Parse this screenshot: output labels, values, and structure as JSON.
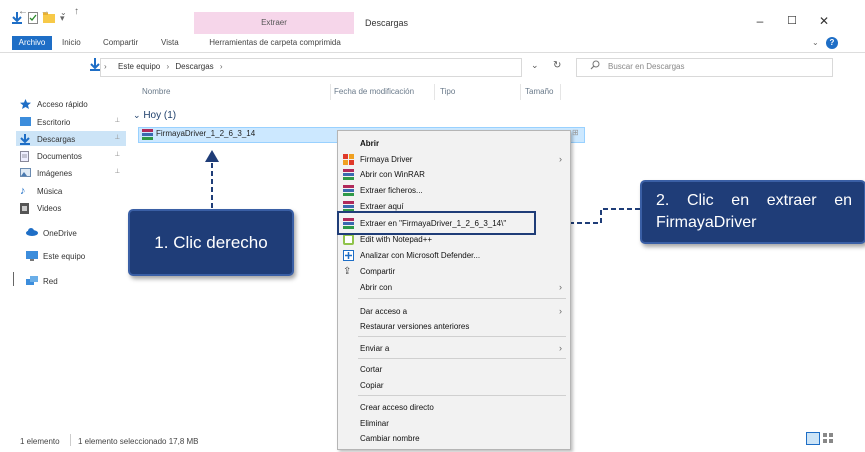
{
  "window": {
    "title": "Descargas",
    "contextual_header": "Extraer"
  },
  "ribbon": {
    "tabs": [
      "Archivo",
      "Inicio",
      "Compartir",
      "Vista"
    ],
    "contextual_tab": "Herramientas de carpeta comprimida"
  },
  "address": {
    "breadcrumb": [
      "Este equipo",
      "Descargas"
    ],
    "search_placeholder": "Buscar en Descargas"
  },
  "nav": {
    "items": [
      {
        "label": "Acceso rápido",
        "icon": "star-icon"
      },
      {
        "label": "Escritorio",
        "icon": "desktop-folder-icon"
      },
      {
        "label": "Descargas",
        "icon": "download-arrow-icon"
      },
      {
        "label": "Documentos",
        "icon": "documents-icon"
      },
      {
        "label": "Imágenes",
        "icon": "pictures-icon"
      },
      {
        "label": "Música",
        "icon": "music-note-icon"
      },
      {
        "label": "Videos",
        "icon": "video-icon"
      },
      {
        "label": "OneDrive",
        "icon": "cloud-icon"
      },
      {
        "label": "Este equipo",
        "icon": "computer-icon"
      },
      {
        "label": "Red",
        "icon": "network-icon"
      }
    ]
  },
  "columns": [
    "Nombre",
    "Fecha de modificación",
    "Tipo",
    "Tamaño"
  ],
  "group": {
    "label": "Hoy (1)"
  },
  "file": {
    "name": "FirmayaDriver_1_2_6_3_14"
  },
  "context_menu": {
    "items": [
      "Abrir",
      "Firmaya Driver",
      "Abrir con WinRAR",
      "Extraer ficheros...",
      "Extraer aquí",
      "Extraer en \"FirmayaDriver_1_2_6_3_14\\\"",
      "Edit with Notepad++",
      "Analizar con Microsoft Defender...",
      "Compartir",
      "Abrir con",
      "Dar acceso a",
      "Restaurar versiones anteriores",
      "Enviar a",
      "Cortar",
      "Copiar",
      "Crear acceso directo",
      "Eliminar",
      "Cambiar nombre"
    ]
  },
  "annotations": {
    "step1": "1. Clic derecho",
    "step2_line1": "2. Clic en extraer en",
    "step2_line2": "FirmayaDriver"
  },
  "status": {
    "items_count": "1 elemento",
    "selected": "1 elemento seleccionado 17,8 MB"
  },
  "colors": {
    "accent": "#1e6ec6",
    "callout_bg": "#1f3d78",
    "selection": "#cce8ff"
  }
}
